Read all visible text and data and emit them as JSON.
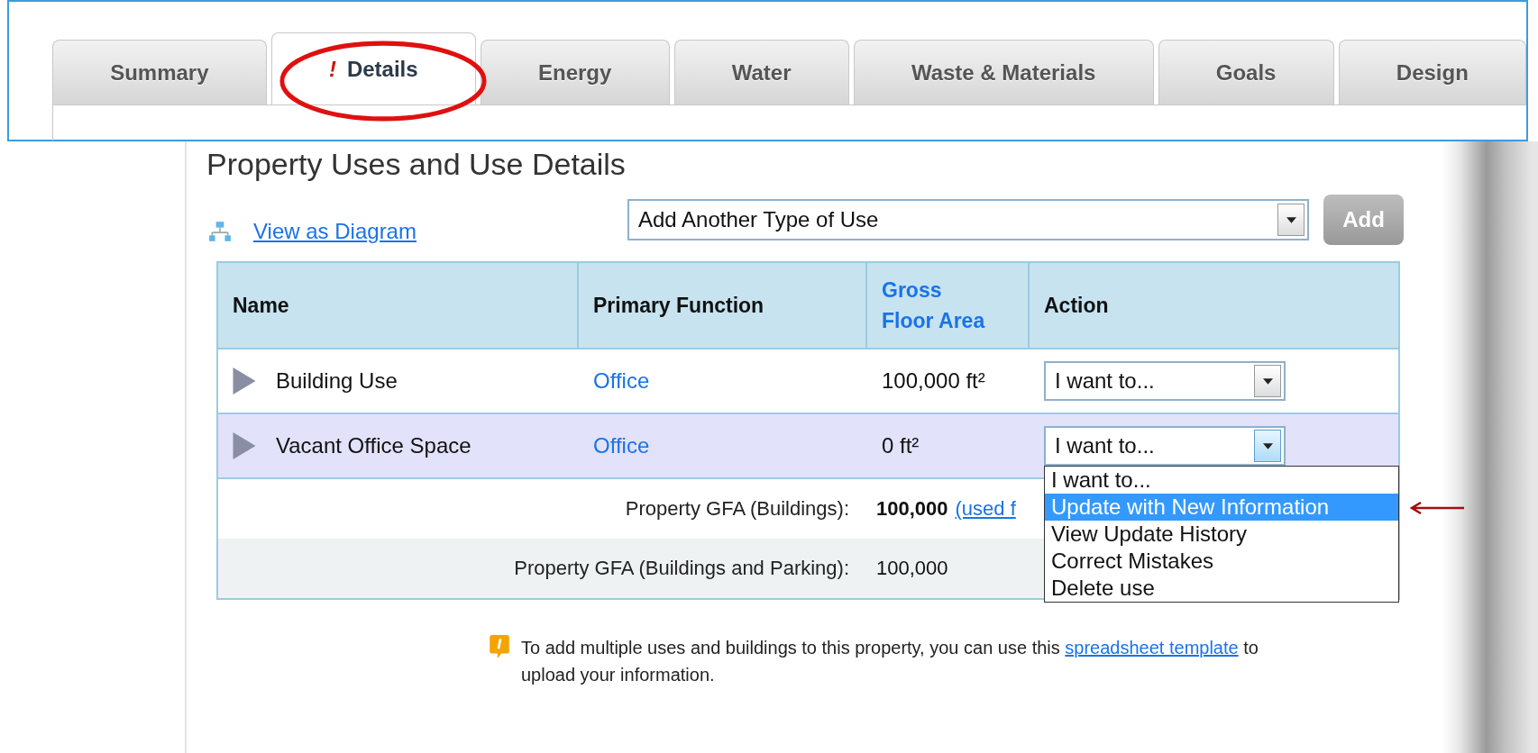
{
  "tabs": [
    {
      "label": "Summary",
      "selected": false,
      "circled": false
    },
    {
      "label": "Details",
      "selected": true,
      "circled": true,
      "flag": "!"
    },
    {
      "label": "Energy",
      "selected": false,
      "circled": false
    },
    {
      "label": "Water",
      "selected": false,
      "circled": false
    },
    {
      "label": "Waste & Materials",
      "selected": false,
      "circled": false
    },
    {
      "label": "Goals",
      "selected": false,
      "circled": false
    },
    {
      "label": "Design",
      "selected": false,
      "circled": false
    }
  ],
  "heading": "Property Uses and Use Details",
  "diagram_link": "View as Diagram",
  "type_select": {
    "value": "Add Another Type of Use"
  },
  "add_button": {
    "label": "Add",
    "disabled": true
  },
  "table": {
    "columns": [
      {
        "label": "Name",
        "link": false
      },
      {
        "label": "Primary Function",
        "link": false
      },
      {
        "label": "Gross Floor Area",
        "link": true
      },
      {
        "label": "Action",
        "link": false
      }
    ],
    "rows": [
      {
        "name": "Building Use",
        "expanded": false,
        "function": "Office",
        "gfa": "100,000 ft²",
        "action": "I want to...",
        "selected": false,
        "menu_open": false
      },
      {
        "name": "Vacant Office Space",
        "expanded": false,
        "function": "Office",
        "gfa": "0 ft²",
        "action": "I want to...",
        "selected": true,
        "menu_open": true
      }
    ],
    "totals": [
      {
        "label": "Property GFA (Buildings):",
        "value": "100,000",
        "bold": true,
        "note": "(used f"
      },
      {
        "label": "Property GFA (Buildings and Parking):",
        "value": "100,000",
        "bold": false
      }
    ]
  },
  "action_menu": {
    "pointer_arrow": true,
    "options": [
      {
        "label": "I want to...",
        "selected": false
      },
      {
        "label": "Update with New Information",
        "selected": true
      },
      {
        "label": "View Update History",
        "selected": false
      },
      {
        "label": "Correct Mistakes",
        "selected": false
      },
      {
        "label": "Delete use",
        "selected": false
      }
    ]
  },
  "note": {
    "before": "To add multiple uses and buildings to this property, you can use this",
    "link": "spreadsheet template",
    "after": "to upload your information."
  }
}
